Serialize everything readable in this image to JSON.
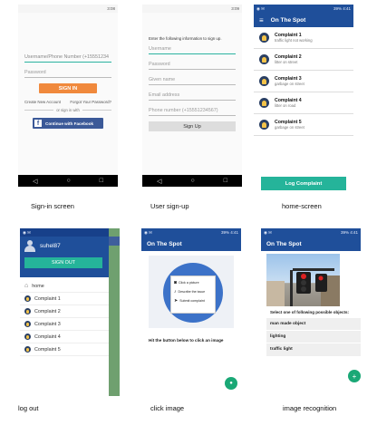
{
  "signin": {
    "status_time": "3:08",
    "username_placeholder": "Username/Phone Number (+15551234",
    "password_placeholder": "Password",
    "signin_button": "SIGN IN",
    "create_account": "Create New Account",
    "forgot_password": "Forgot Your Password?",
    "or_sign_in_with": "or sign in with",
    "facebook_button": "Continue with Facebook",
    "caption": "Sign-in screen"
  },
  "signup": {
    "status_time": "3:09",
    "instruction": "Enter the following information to sign up.",
    "username_placeholder": "Username",
    "password_placeholder": "Password",
    "given_name_placeholder": "Given name",
    "email_placeholder": "Email address",
    "phone_placeholder": "Phone number (+15551234567)",
    "signup_button": "Sign Up",
    "caption": "User sign-up"
  },
  "home": {
    "status_time": "39% 4:41",
    "title": "On The Spot",
    "complaints": [
      {
        "title": "Complaint 1",
        "subtitle": "traffic light not working"
      },
      {
        "title": "Complaint 2",
        "subtitle": "litter on street"
      },
      {
        "title": "Complaint 3",
        "subtitle": "garbage on street"
      },
      {
        "title": "Complaint 4",
        "subtitle": "litter on road"
      },
      {
        "title": "Complaint 5",
        "subtitle": "garbage on street"
      }
    ],
    "log_complaint_button": "Log Complaint",
    "caption": "home-screen"
  },
  "logout": {
    "status_time": "39% 4:41",
    "username": "suhel87",
    "signout_button": "SIGN OUT",
    "menu_home": "home",
    "complaints": [
      "Complaint 1",
      "Complaint 2",
      "Complaint 3",
      "Complaint 4",
      "Complaint 5"
    ],
    "caption": "log out"
  },
  "click_image": {
    "status_time": "39% 4:41",
    "title": "On The Spot",
    "menu_items": [
      "Click a picture",
      "Describe the issue",
      "Submit complaint"
    ],
    "hint": "Hit the button below to click an image",
    "fab_icon": "camera-icon",
    "caption": "click image"
  },
  "recognition": {
    "status_time": "39% 4:41",
    "title": "On The Spot",
    "prompt": "Select one of following possible objects:",
    "options": [
      "man made object",
      "lighting",
      "traffic light"
    ],
    "fab_icon": "add-icon",
    "caption": "image recognition"
  },
  "colors": {
    "brand_blue": "#1f4f9a",
    "signin_orange": "#f0893c",
    "facebook_blue": "#3b5998",
    "teal": "#25b49a",
    "fab_green": "#1aa876"
  }
}
